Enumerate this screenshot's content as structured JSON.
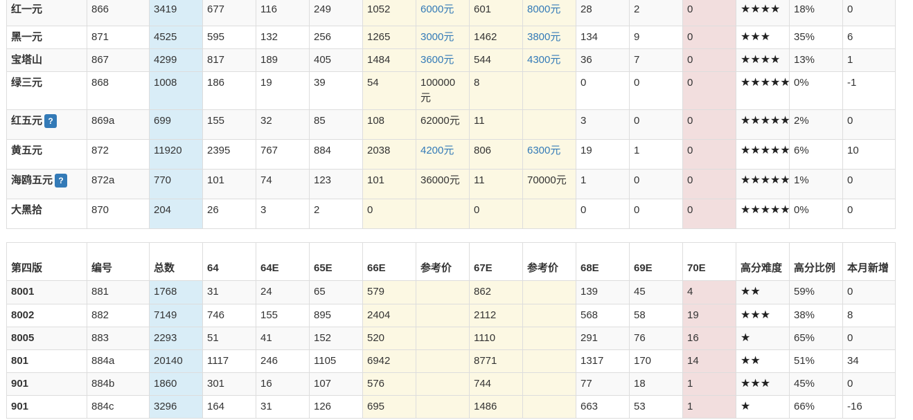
{
  "table1": {
    "rows": [
      {
        "name": "红一元",
        "help": false,
        "code": "866",
        "total": "3419",
        "c64": "677",
        "c64e": "116",
        "c65e": "249",
        "c66e": "1052",
        "ref1": "6000元",
        "ref1_link": true,
        "c67e": "601",
        "ref2": "8000元",
        "ref2_link": true,
        "c68e": "28",
        "c69e": "2",
        "c70e": "0",
        "stars": "★★★★",
        "ratio": "18%",
        "new": "0"
      },
      {
        "name": "黑一元",
        "help": false,
        "code": "871",
        "total": "4525",
        "c64": "595",
        "c64e": "132",
        "c65e": "256",
        "c66e": "1265",
        "ref1": "3000元",
        "ref1_link": true,
        "c67e": "1462",
        "ref2": "3800元",
        "ref2_link": true,
        "c68e": "134",
        "c69e": "9",
        "c70e": "0",
        "stars": "★★★",
        "ratio": "35%",
        "new": "6"
      },
      {
        "name": "宝塔山",
        "help": false,
        "code": "867",
        "total": "4299",
        "c64": "817",
        "c64e": "189",
        "c65e": "405",
        "c66e": "1484",
        "ref1": "3600元",
        "ref1_link": true,
        "c67e": "544",
        "ref2": "4300元",
        "ref2_link": true,
        "c68e": "36",
        "c69e": "7",
        "c70e": "0",
        "stars": "★★★★",
        "ratio": "13%",
        "new": "1"
      },
      {
        "name": "绿三元",
        "help": false,
        "code": "868",
        "total": "1008",
        "c64": "186",
        "c64e": "19",
        "c65e": "39",
        "c66e": "54",
        "ref1": "100000元",
        "ref1_link": false,
        "c67e": "8",
        "ref2": "",
        "ref2_link": false,
        "c68e": "0",
        "c69e": "0",
        "c70e": "0",
        "stars": "★★★★★",
        "ratio": "0%",
        "new": "-1"
      },
      {
        "name": "红五元",
        "help": true,
        "code": "869a",
        "total": "699",
        "c64": "155",
        "c64e": "32",
        "c65e": "85",
        "c66e": "108",
        "ref1": "62000元",
        "ref1_link": false,
        "c67e": "11",
        "ref2": "",
        "ref2_link": false,
        "c68e": "3",
        "c69e": "0",
        "c70e": "0",
        "stars": "★★★★★",
        "ratio": "2%",
        "new": "0"
      },
      {
        "name": "黄五元",
        "help": false,
        "code": "872",
        "total": "11920",
        "c64": "2395",
        "c64e": "767",
        "c65e": "884",
        "c66e": "2038",
        "ref1": "4200元",
        "ref1_link": true,
        "c67e": "806",
        "ref2": "6300元",
        "ref2_link": true,
        "c68e": "19",
        "c69e": "1",
        "c70e": "0",
        "stars": "★★★★★",
        "ratio": "6%",
        "new": "10"
      },
      {
        "name": "海鸥五元",
        "help": true,
        "code": "872a",
        "total": "770",
        "c64": "101",
        "c64e": "74",
        "c65e": "123",
        "c66e": "101",
        "ref1": "36000元",
        "ref1_link": false,
        "c67e": "11",
        "ref2": "70000元",
        "ref2_link": false,
        "c68e": "1",
        "c69e": "0",
        "c70e": "0",
        "stars": "★★★★★",
        "ratio": "1%",
        "new": "0"
      },
      {
        "name": "大黑拾",
        "help": false,
        "code": "870",
        "total": "204",
        "c64": "26",
        "c64e": "3",
        "c65e": "2",
        "c66e": "0",
        "ref1": "",
        "ref1_link": false,
        "c67e": "0",
        "ref2": "",
        "ref2_link": false,
        "c68e": "0",
        "c69e": "0",
        "c70e": "0",
        "stars": "★★★★★",
        "ratio": "0%",
        "new": "0"
      }
    ],
    "help_label": "?"
  },
  "table2": {
    "headers": [
      "第四版",
      "编号",
      "总数",
      "64",
      "64E",
      "65E",
      "66E",
      "参考价",
      "67E",
      "参考价",
      "68E",
      "69E",
      "70E",
      "高分难度",
      "高分比例",
      "本月新增"
    ],
    "rows": [
      {
        "name": "8001",
        "code": "881",
        "total": "1768",
        "c64": "31",
        "c64e": "24",
        "c65e": "65",
        "c66e": "579",
        "ref1": "",
        "c67e": "862",
        "ref2": "",
        "c68e": "139",
        "c69e": "45",
        "c70e": "4",
        "stars": "★★",
        "ratio": "59%",
        "new": "0"
      },
      {
        "name": "8002",
        "code": "882",
        "total": "7149",
        "c64": "746",
        "c64e": "155",
        "c65e": "895",
        "c66e": "2404",
        "ref1": "",
        "c67e": "2112",
        "ref2": "",
        "c68e": "568",
        "c69e": "58",
        "c70e": "19",
        "stars": "★★★",
        "ratio": "38%",
        "new": "8"
      },
      {
        "name": "8005",
        "code": "883",
        "total": "2293",
        "c64": "51",
        "c64e": "41",
        "c65e": "152",
        "c66e": "520",
        "ref1": "",
        "c67e": "1110",
        "ref2": "",
        "c68e": "291",
        "c69e": "76",
        "c70e": "16",
        "stars": "★",
        "ratio": "65%",
        "new": "0"
      },
      {
        "name": "801",
        "code": "884a",
        "total": "20140",
        "c64": "1117",
        "c64e": "246",
        "c65e": "1105",
        "c66e": "6942",
        "ref1": "",
        "c67e": "8771",
        "ref2": "",
        "c68e": "1317",
        "c69e": "170",
        "c70e": "14",
        "stars": "★★",
        "ratio": "51%",
        "new": "34"
      },
      {
        "name": "901",
        "code": "884b",
        "total": "1860",
        "c64": "301",
        "c64e": "16",
        "c65e": "107",
        "c66e": "576",
        "ref1": "",
        "c67e": "744",
        "ref2": "",
        "c68e": "77",
        "c69e": "18",
        "c70e": "1",
        "stars": "★★★",
        "ratio": "45%",
        "new": "0"
      },
      {
        "name": "901",
        "code": "884c",
        "total": "3296",
        "c64": "164",
        "c64e": "31",
        "c65e": "126",
        "c66e": "695",
        "ref1": "",
        "c67e": "1486",
        "ref2": "",
        "c68e": "663",
        "c69e": "53",
        "c70e": "1",
        "stars": "★",
        "ratio": "66%",
        "new": "-16"
      }
    ]
  },
  "colors": {
    "blue": "#d9edf7",
    "yellow": "#fcf8e3",
    "red": "#f2dede",
    "link": "#337ab7",
    "help_button": "#337ab7",
    "stripe": "#f9f9f9"
  }
}
